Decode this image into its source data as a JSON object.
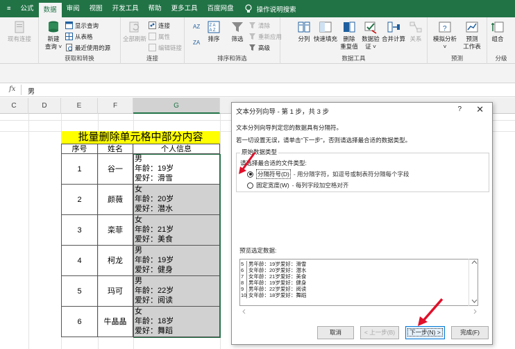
{
  "tabs": [
    "≡",
    "公式",
    "数据",
    "审阅",
    "视图",
    "开发工具",
    "帮助",
    "更多工具",
    "百度网盘"
  ],
  "active_tab": "数据",
  "tell_me": "操作说明搜索",
  "ribbon": {
    "conn_stub": "现有连接",
    "get": {
      "new_query": "新建",
      "new_query2": "查询 ˅",
      "show_queries": "显示查询",
      "from_table": "从表格",
      "recent_sources": "最近使用的源",
      "label": "获取和转换"
    },
    "connections": {
      "refresh_all": "全部刷新",
      "connections": "连接",
      "properties": "属性",
      "edit_links": "编辑链接",
      "label": "连接"
    },
    "sort_filter": {
      "sort": "排序",
      "filter": "筛选",
      "clear": "清除",
      "reapply": "重新应用",
      "advanced": "高级",
      "label": "排序和筛选"
    },
    "data_tools": {
      "split": "分列",
      "flash_fill": "快速填充",
      "remove_dup": "删除",
      "remove_dup2": "重复值",
      "validation": "数据验",
      "validation2": "证 ˅",
      "consolidate": "合并计算",
      "relationships": "关系",
      "label": "数据工具"
    },
    "forecast": {
      "what_if": "模拟分析",
      "what_if2": "˅",
      "forecast_sheet": "预测",
      "forecast_sheet2": "工作表",
      "label": "预测"
    },
    "outline": {
      "group": "组合",
      "label": "分级"
    }
  },
  "formula_bar": {
    "fx": "fx",
    "value": "男"
  },
  "columns": [
    "C",
    "D",
    "E",
    "F",
    "G"
  ],
  "sheet": {
    "title": "批量删除单元格中部分内容",
    "headers": [
      "序号",
      "姓名",
      "个人信息"
    ],
    "rows": [
      {
        "num": "1",
        "name": "谷一",
        "info": [
          "男",
          "年龄：19岁",
          "爱好：滑雪"
        ]
      },
      {
        "num": "2",
        "name": "颜薇",
        "info": [
          "女",
          "年龄：20岁",
          "爱好：潜水"
        ]
      },
      {
        "num": "3",
        "name": "栾菲",
        "info": [
          "女",
          "年龄：21岁",
          "爱好：美食"
        ]
      },
      {
        "num": "4",
        "name": "柯龙",
        "info": [
          "男",
          "年龄：19岁",
          "爱好：健身"
        ]
      },
      {
        "num": "5",
        "name": "玛可",
        "info": [
          "男",
          "年龄：22岁",
          "爱好：阅读"
        ]
      },
      {
        "num": "6",
        "name": "牛晶晶",
        "info": [
          "女",
          "年龄：18岁",
          "爱好：舞蹈"
        ]
      }
    ]
  },
  "dialog": {
    "title": "文本分列向导 - 第 1 步，共 3 步",
    "help": "?",
    "close": "✕",
    "line1": "文本分列向导判定您的数据具有分隔符。",
    "line2": "若一切设置无误，请单击“下一步”，否则请选择最合适的数据类型。",
    "original_type": "原始数据类型",
    "choose_type": "请选择最合适的文件类型:",
    "radio_delimited": "分隔符号(D)",
    "radio_delimited_desc": "- 用分隔字符，如逗号或制表符分隔每个字段",
    "radio_fixed": "固定宽度(W)",
    "radio_fixed_desc": "- 每列字段加空格对齐",
    "preview_label": "预览选定数据:",
    "preview_rows": [
      {
        "n": "5",
        "t": "男年龄：19岁爱好：滑雪"
      },
      {
        "n": "6",
        "t": "女年龄：20岁爱好：潜水"
      },
      {
        "n": "7",
        "t": "女年龄：21岁爱好：美食"
      },
      {
        "n": "8",
        "t": "男年龄：19岁爱好：健身"
      },
      {
        "n": "9",
        "t": "男年龄：22岁爱好：阅读"
      },
      {
        "n": "10",
        "t": "女年龄：18岁爱好：舞蹈"
      }
    ],
    "btn_cancel": "取消",
    "btn_back": "< 上一步(B)",
    "btn_next": "下一步(N) >",
    "btn_finish": "完成(F)"
  },
  "colors": {
    "excel_green": "#217346",
    "title_fill": "#ffff00",
    "arrow": "#e0102a",
    "selection_gray": "#d1d1d1"
  }
}
